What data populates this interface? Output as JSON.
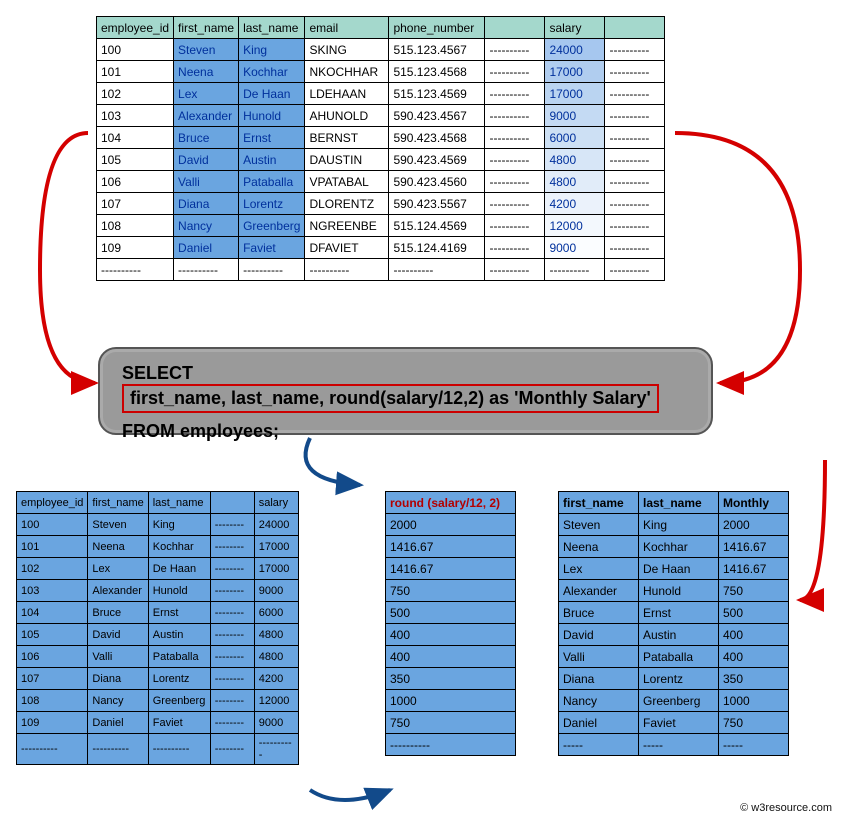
{
  "copyright": "© w3resource.com",
  "sql": {
    "select_keyword": "SELECT",
    "select_clause": "first_name, last_name, round(salary/12,2) as 'Monthly Salary'",
    "from_clause": "FROM employees;"
  },
  "top": {
    "headers": [
      "employee_id",
      "first_name",
      "last_name",
      "email",
      "phone_number",
      "",
      "salary",
      ""
    ],
    "rows": [
      [
        "100",
        "Steven",
        "King",
        "SKING",
        "515.123.4567",
        "----------",
        "24000",
        "----------"
      ],
      [
        "101",
        "Neena",
        "Kochhar",
        "NKOCHHAR",
        "515.123.4568",
        "----------",
        "17000",
        "----------"
      ],
      [
        "102",
        "Lex",
        "De Haan",
        "LDEHAAN",
        "515.123.4569",
        "----------",
        "17000",
        "----------"
      ],
      [
        "103",
        "Alexander",
        "Hunold",
        "AHUNOLD",
        "590.423.4567",
        "----------",
        "9000",
        "----------"
      ],
      [
        "104",
        "Bruce",
        "Ernst",
        "BERNST",
        "590.423.4568",
        "----------",
        "6000",
        "----------"
      ],
      [
        "105",
        "David",
        "Austin",
        "DAUSTIN",
        "590.423.4569",
        "----------",
        "4800",
        "----------"
      ],
      [
        "106",
        "Valli",
        "Pataballa",
        "VPATABAL",
        "590.423.4560",
        "----------",
        "4800",
        "----------"
      ],
      [
        "107",
        "Diana",
        "Lorentz",
        "DLORENTZ",
        "590.423.5567",
        "----------",
        "4200",
        "----------"
      ],
      [
        "108",
        "Nancy",
        "Greenberg",
        "NGREENBE",
        "515.124.4569",
        "----------",
        "12000",
        "----------"
      ],
      [
        "109",
        "Daniel",
        "Faviet",
        "DFAVIET",
        "515.124.4169",
        "----------",
        "9000",
        "----------"
      ],
      [
        "----------",
        "----------",
        "----------",
        "----------",
        "----------",
        "----------",
        "----------",
        "----------"
      ]
    ]
  },
  "left": {
    "headers": [
      "employee_id",
      "first_name",
      "last_name",
      "",
      "salary"
    ],
    "rows": [
      [
        "100",
        "Steven",
        "King",
        "--------",
        "24000"
      ],
      [
        "101",
        "Neena",
        "Kochhar",
        "--------",
        "17000"
      ],
      [
        "102",
        "Lex",
        "De Haan",
        "--------",
        "17000"
      ],
      [
        "103",
        "Alexander",
        "Hunold",
        "--------",
        "9000"
      ],
      [
        "104",
        "Bruce",
        "Ernst",
        "--------",
        "6000"
      ],
      [
        "105",
        "David",
        "Austin",
        "--------",
        "4800"
      ],
      [
        "106",
        "Valli",
        "Pataballa",
        "--------",
        "4800"
      ],
      [
        "107",
        "Diana",
        "Lorentz",
        "--------",
        "4200"
      ],
      [
        "108",
        "Nancy",
        "Greenberg",
        "--------",
        "12000"
      ],
      [
        "109",
        "Daniel",
        "Faviet",
        "--------",
        "9000"
      ],
      [
        "----------",
        "----------",
        "----------",
        "--------",
        "----------"
      ]
    ]
  },
  "mid": {
    "header": "round (salary/12, 2)",
    "rows": [
      "2000",
      "1416.67",
      "1416.67",
      "750",
      "500",
      "400",
      "400",
      "350",
      "1000",
      "750",
      "----------"
    ]
  },
  "right": {
    "headers": [
      "first_name",
      "last_name",
      "Monthly"
    ],
    "rows": [
      [
        "Steven",
        "King",
        "2000"
      ],
      [
        "Neena",
        "Kochhar",
        "1416.67"
      ],
      [
        "Lex",
        "De Haan",
        "1416.67"
      ],
      [
        "Alexander",
        "Hunold",
        "750"
      ],
      [
        "Bruce",
        "Ernst",
        "500"
      ],
      [
        "David",
        "Austin",
        "400"
      ],
      [
        "Valli",
        "Pataballa",
        "400"
      ],
      [
        "Diana",
        "Lorentz",
        "350"
      ],
      [
        "Nancy",
        "Greenberg",
        "1000"
      ],
      [
        "Daniel",
        "Faviet",
        "750"
      ],
      [
        "-----",
        "-----",
        "-----"
      ]
    ]
  }
}
